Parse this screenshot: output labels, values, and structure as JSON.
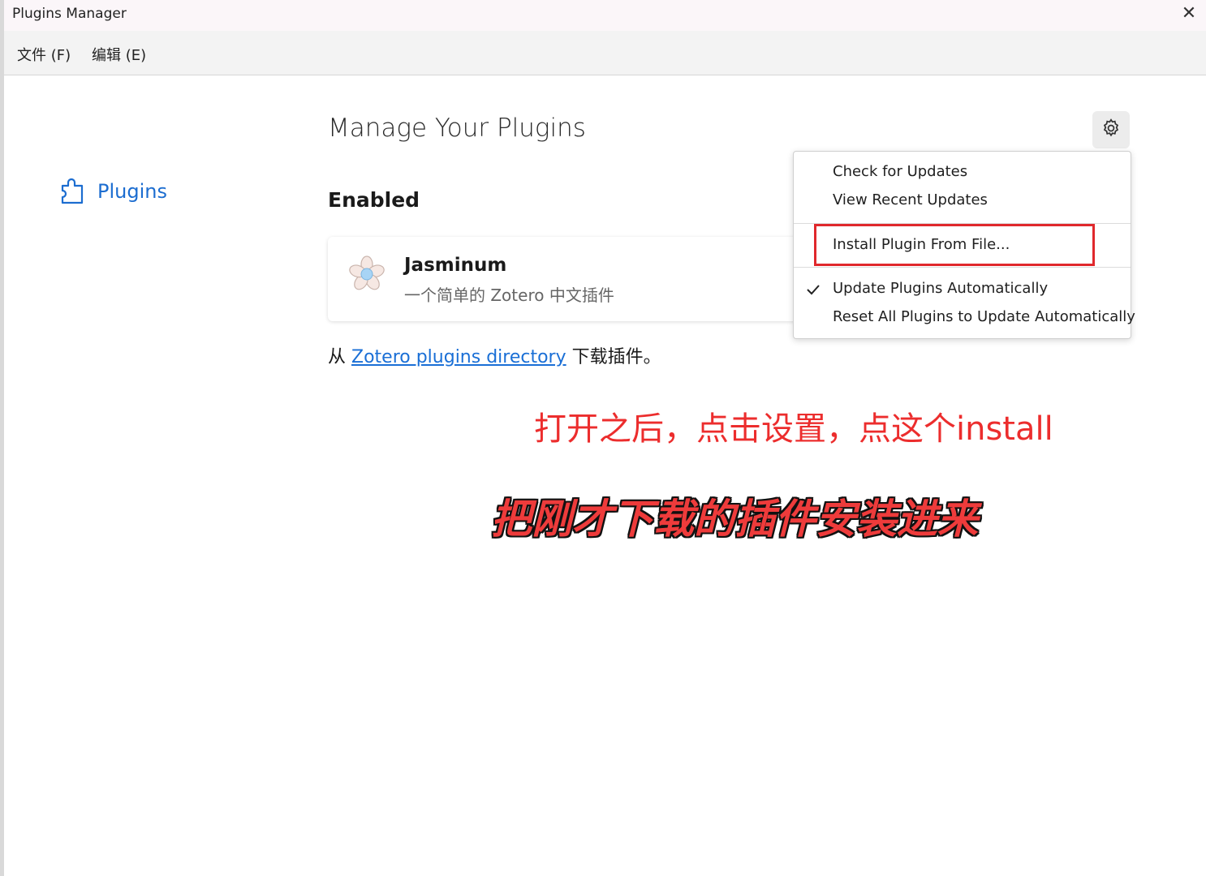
{
  "window": {
    "title": "Plugins Manager",
    "close_label": "✕"
  },
  "menubar": {
    "file_label": "文件 (F)",
    "edit_label": "编辑 (E)"
  },
  "sidebar": {
    "items": [
      {
        "label": "Plugins",
        "icon": "puzzle-icon",
        "active": true
      }
    ]
  },
  "main": {
    "title": "Manage Your Plugins",
    "section_heading": "Enabled",
    "plugins": [
      {
        "name": "Jasminum",
        "description": "一个简单的 Zotero 中文插件",
        "icon": "flower-icon"
      }
    ],
    "download": {
      "prefix": "从 ",
      "link_text": "Zotero plugins directory",
      "suffix": " 下载插件。"
    }
  },
  "gear_menu": {
    "items": [
      {
        "label": "Check for Updates"
      },
      {
        "label": "View Recent Updates"
      },
      {
        "label": "Install Plugin From File..."
      },
      {
        "label": "Update Plugins Automatically",
        "checked": true
      },
      {
        "label": "Reset All Plugins to Update Automatically"
      }
    ]
  },
  "annotations": {
    "line1": "打开之后，点击设置，点这个install",
    "line2": "把刚才下载的插件安装进来",
    "color": "#ec2d2d"
  },
  "colors": {
    "link": "#1a6fd6",
    "accent": "#1c6dd0",
    "highlight_box": "#e0282c"
  }
}
